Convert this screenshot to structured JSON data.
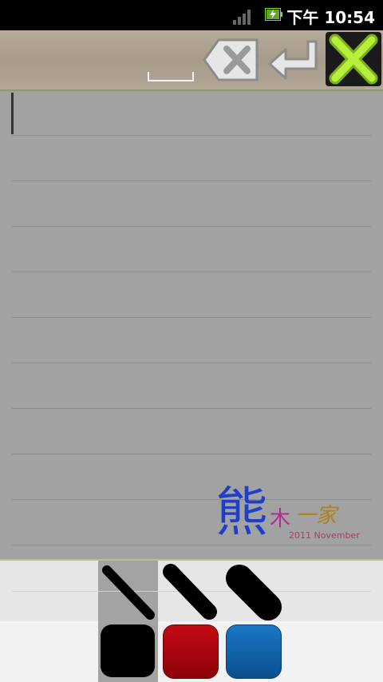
{
  "status_bar": {
    "time": "下午 10:54",
    "icons": [
      "signal-icon",
      "battery-charging-icon"
    ]
  },
  "toolbar": {
    "keys": [
      "space-key",
      "backspace-key",
      "enter-key",
      "close-key"
    ],
    "close_color": "#a6e22e"
  },
  "watermark": {
    "main": "熊",
    "mid": "木",
    "tail": "一家",
    "date": "2011  November"
  },
  "palette": {
    "pens": [
      "thin-pen-icon",
      "medium-pen-icon",
      "thick-pen-icon"
    ],
    "selected_pen": "thin",
    "colors": [
      "#000000",
      "#b0060e",
      "#1466b0"
    ],
    "selected_color": "#000000"
  }
}
